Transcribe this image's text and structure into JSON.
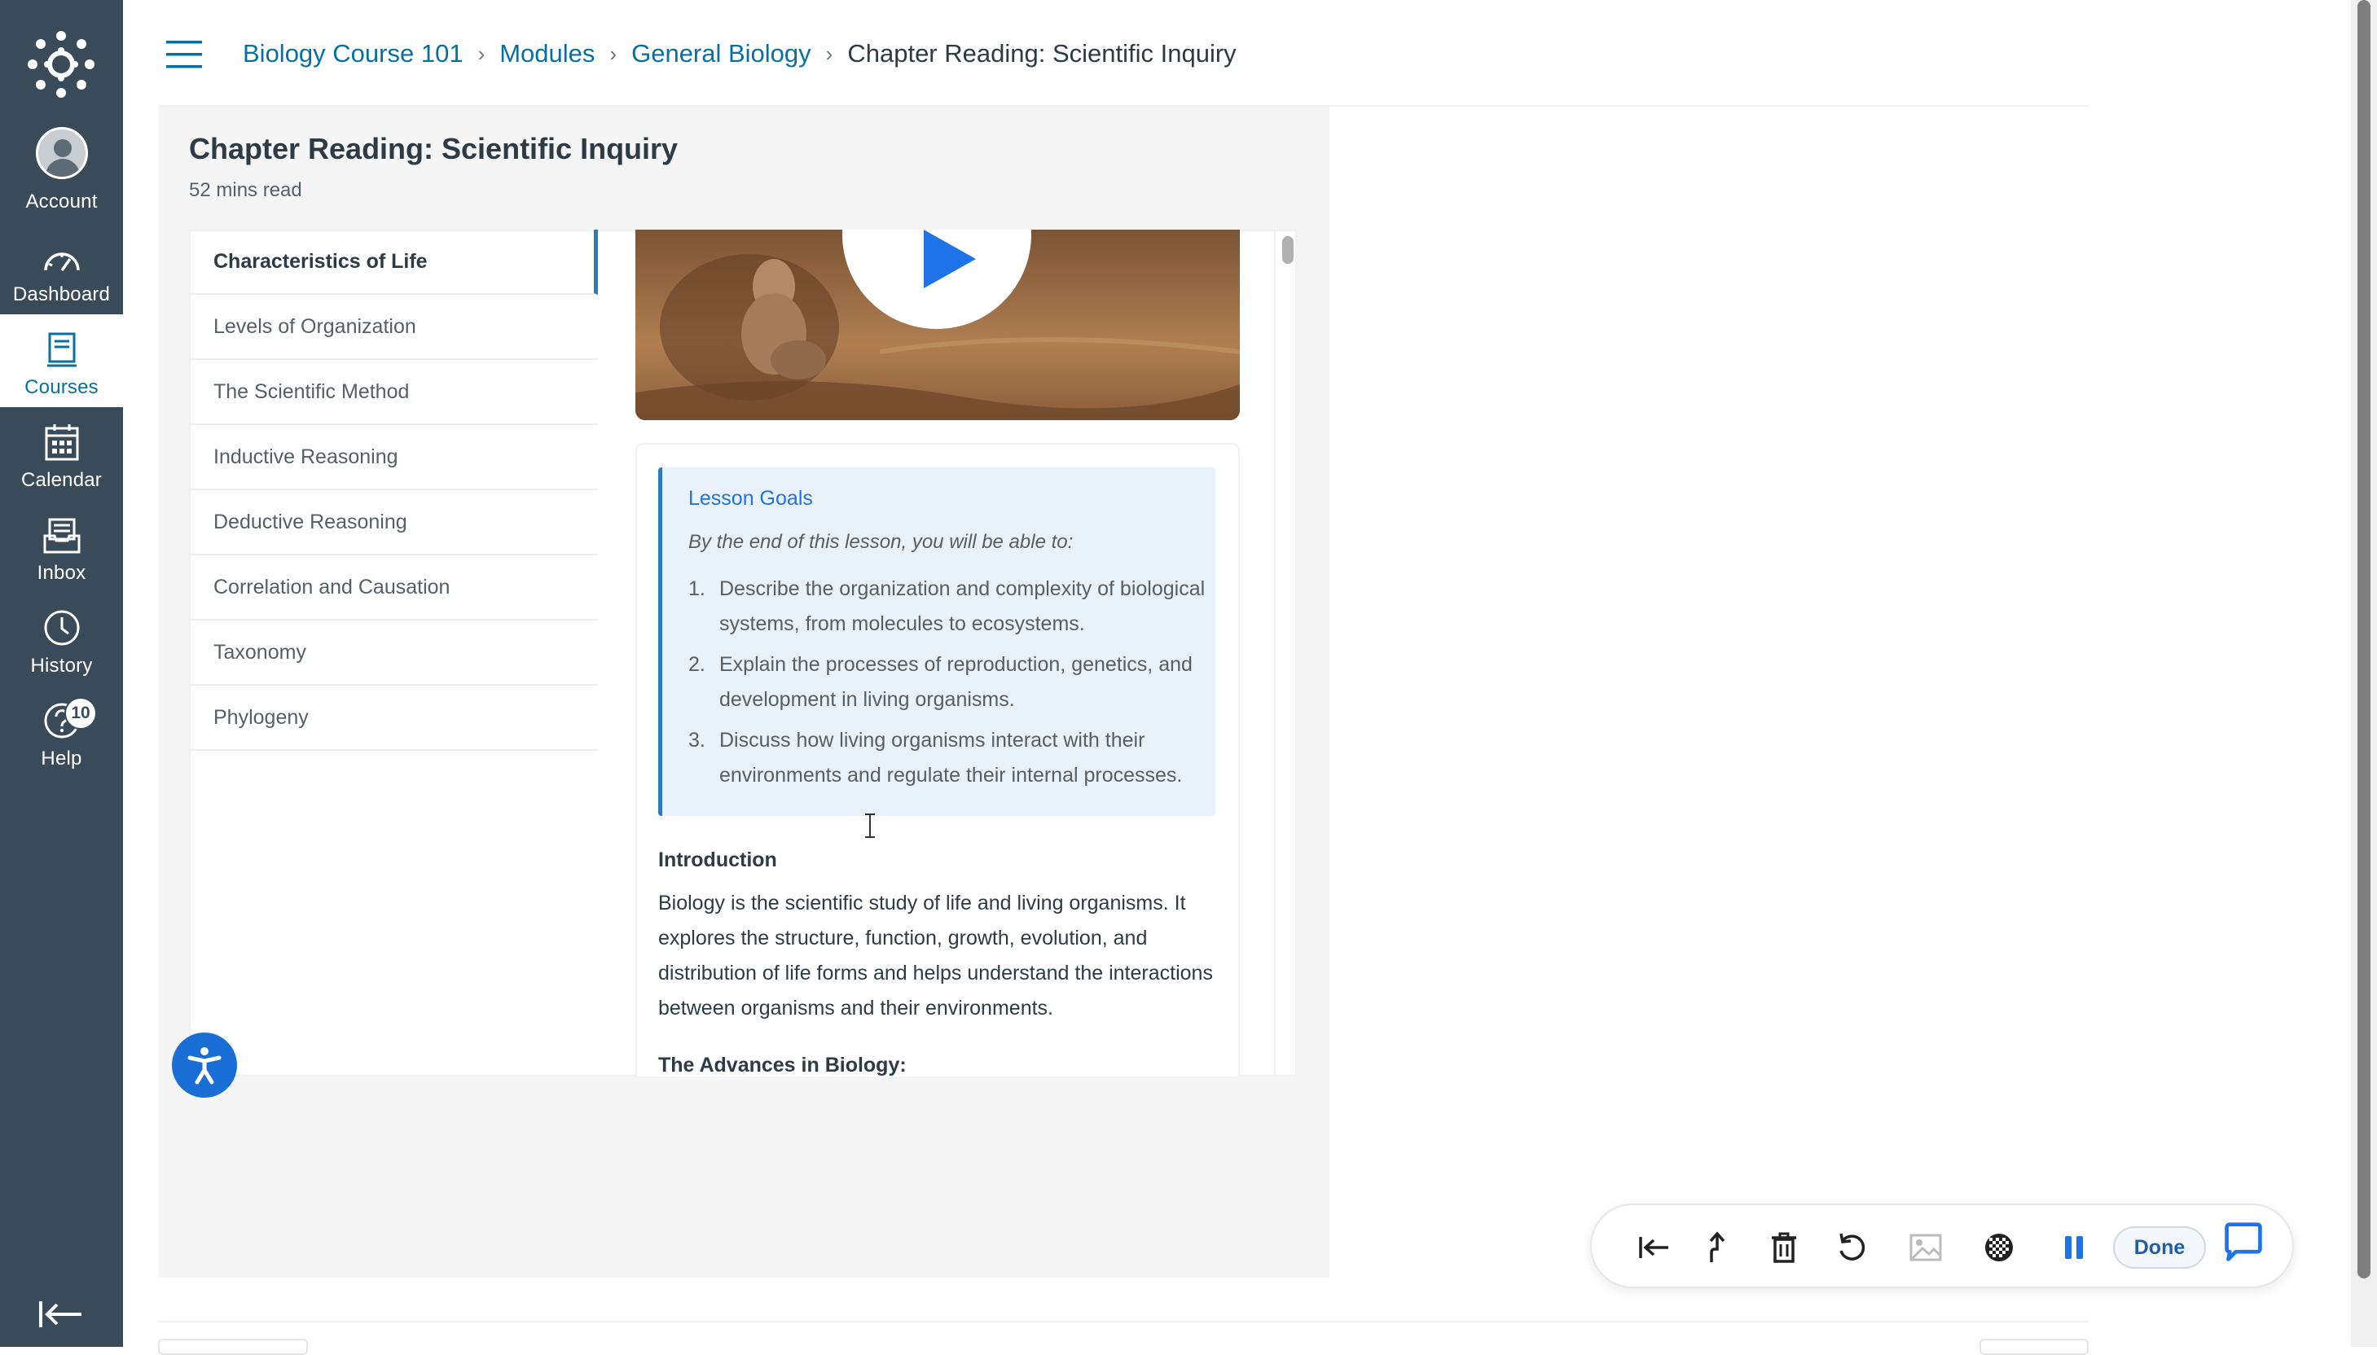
{
  "nav": {
    "account": "Account",
    "dashboard": "Dashboard",
    "courses": "Courses",
    "calendar": "Calendar",
    "inbox": "Inbox",
    "history": "History",
    "help": "Help",
    "help_badge": "10",
    "icons": [
      "canvas-logo-icon",
      "avatar",
      "dashboard-icon",
      "courses-icon",
      "calendar-icon",
      "inbox-icon",
      "history-icon",
      "help-icon",
      "collapse-nav-icon"
    ]
  },
  "breadcrumb": {
    "course": "Biology Course 101",
    "modules": "Modules",
    "module": "General Biology",
    "current": "Chapter Reading: Scientific Inquiry"
  },
  "page": {
    "title": "Chapter Reading: Scientific Inquiry",
    "read_time": "52 mins read"
  },
  "toc": {
    "items": [
      "Characteristics of Life",
      "Levels of Organization",
      "The Scientific Method",
      "Inductive Reasoning",
      "Deductive Reasoning",
      "Correlation and Causation",
      "Taxonomy",
      "Phylogeny"
    ],
    "active_index": 0
  },
  "goals": {
    "title": "Lesson Goals",
    "intro": "By the end of this lesson, you will be able to:",
    "items": [
      {
        "num": "1.",
        "text": "Describe the organization and complexity of biological systems, from molecules to ecosystems."
      },
      {
        "num": "2.",
        "text": "Explain the processes of reproduction, genetics, and development in living organisms."
      },
      {
        "num": "3.",
        "text": "Discuss how living organisms interact with their environments and regulate their internal processes."
      }
    ]
  },
  "article": {
    "intro_heading": "Introduction",
    "intro_text": "Biology is the scientific study of life and living organisms. It explores the structure, function, growth, evolution, and distribution of life forms and helps understand the interactions between organisms and their environments.",
    "advances_heading": "The Advances in Biology:"
  },
  "toolbar": {
    "done": "Done",
    "icons": [
      "skip-to-start-icon",
      "pointer-up-icon",
      "trash-icon",
      "undo-icon",
      "image-icon",
      "blur-icon",
      "pause-icon",
      "chat-icon"
    ]
  },
  "colors": {
    "nav_bg": "#394b58",
    "link": "#0770a3",
    "accent": "#1f73e8",
    "goals_bg": "#e9f2fb"
  }
}
